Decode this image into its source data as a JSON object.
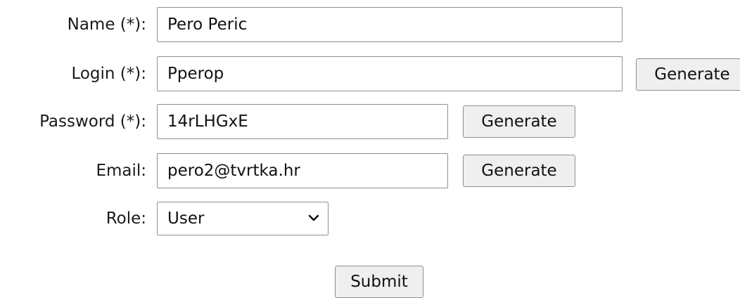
{
  "form": {
    "name": {
      "label": "Name (*):",
      "value": "Pero Peric"
    },
    "login": {
      "label": "Login (*):",
      "value": "Pperop",
      "generate_label": "Generate"
    },
    "password": {
      "label": "Password (*):",
      "value": "14rLHGxE",
      "generate_label": "Generate"
    },
    "email": {
      "label": "Email:",
      "value": "pero2@tvrtka.hr",
      "generate_label": "Generate"
    },
    "role": {
      "label": "Role:",
      "selected": "User"
    },
    "submit_label": "Submit"
  },
  "icons": {
    "role_dropdown": "chevron-down-icon"
  }
}
